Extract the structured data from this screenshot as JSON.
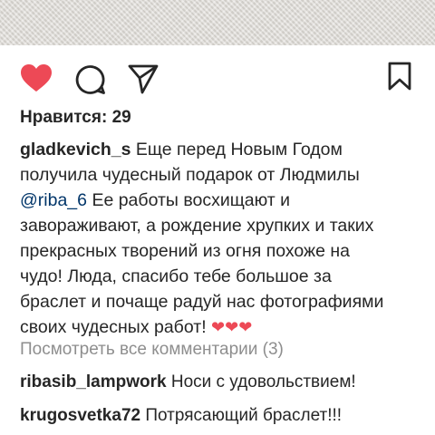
{
  "post": {
    "likes_label": "Нравится: 29",
    "caption": {
      "username": "gladkevich_s",
      "line1": "Еще перед Новым Годом",
      "line2": "получила чудесный подарок от Людмилы",
      "mention": "@riba_6",
      "line3": "Ее работы  восхищают и",
      "line4": "завораживают, а рождение хрупких и таких",
      "line5": "прекрасных творений из огня похоже на",
      "line6": "чудо! Люда, спасибо тебе большое за",
      "line7": "браслет и почаще радуй нас фотографиями",
      "line8": "своих чудесных работ!",
      "hearts": "❤❤❤"
    },
    "view_all_comments": "Посмотреть все комментарии (3)",
    "comments": [
      {
        "username": "ribasib_lampwork",
        "text": "Носи с удовольствием!"
      },
      {
        "username": "krugosvetka72",
        "text": "Потрясающий браслет!!!"
      }
    ]
  },
  "icons": {
    "like": "heart-icon",
    "comment": "speech-bubble-icon",
    "share": "paper-plane-icon",
    "save": "bookmark-icon"
  },
  "colors": {
    "like_active": "#ed4956",
    "text": "#262626",
    "mention": "#003569",
    "muted": "#8e8e8e"
  }
}
